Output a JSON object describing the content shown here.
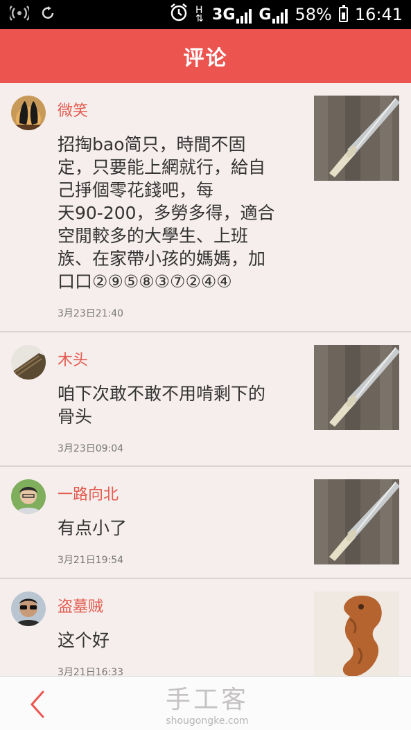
{
  "status_bar": {
    "network_1": "3G",
    "network_2": "G",
    "battery": "58%",
    "time": "16:41"
  },
  "header": {
    "title": "评论"
  },
  "comments": [
    {
      "user": "微笑",
      "text": "招掏bao简只，時間不固定，只要能上網就行，給自己掙個零花錢吧，每天90-200，多勞多得，適合空閒較多的大學生、上班族、在家帶小孩的媽媽，加口口②⑨⑤⑧③⑦②④④",
      "lines": [
        "招掏bao简只，時間不固",
        "定，只要能上網就行，給自",
        "己掙個零花錢吧，每",
        "天90-200，多勞多得，適合",
        "空閒較多的大學生、上班",
        "族、在家帶小孩的媽媽，加",
        "口口②⑨⑤⑧③⑦②④④"
      ],
      "time": "3月23日21:40",
      "thumb": "knife-photo"
    },
    {
      "user": "木头",
      "text": "咱下次敢不敢不用啃剩下的骨头",
      "lines": [
        "咱下次敢不敢不用啃剩下的",
        "骨头"
      ],
      "time": "3月23日09:04",
      "thumb": "knife-photo"
    },
    {
      "user": "一路向北",
      "text": "有点小了",
      "lines": [
        "有点小了"
      ],
      "time": "3月21日19:54",
      "thumb": "knife-photo"
    },
    {
      "user": "盗墓贼",
      "text": "这个好",
      "lines": [
        "这个好"
      ],
      "time": "3月21日16:33",
      "thumb": "seahorse-carving-photo"
    }
  ],
  "bottom_bar": {
    "logo_cn": "手工客",
    "logo_en": "shougongke.com"
  },
  "colors": {
    "accent": "#ec5450",
    "username": "#e35a4f",
    "background": "#f6eeec"
  }
}
